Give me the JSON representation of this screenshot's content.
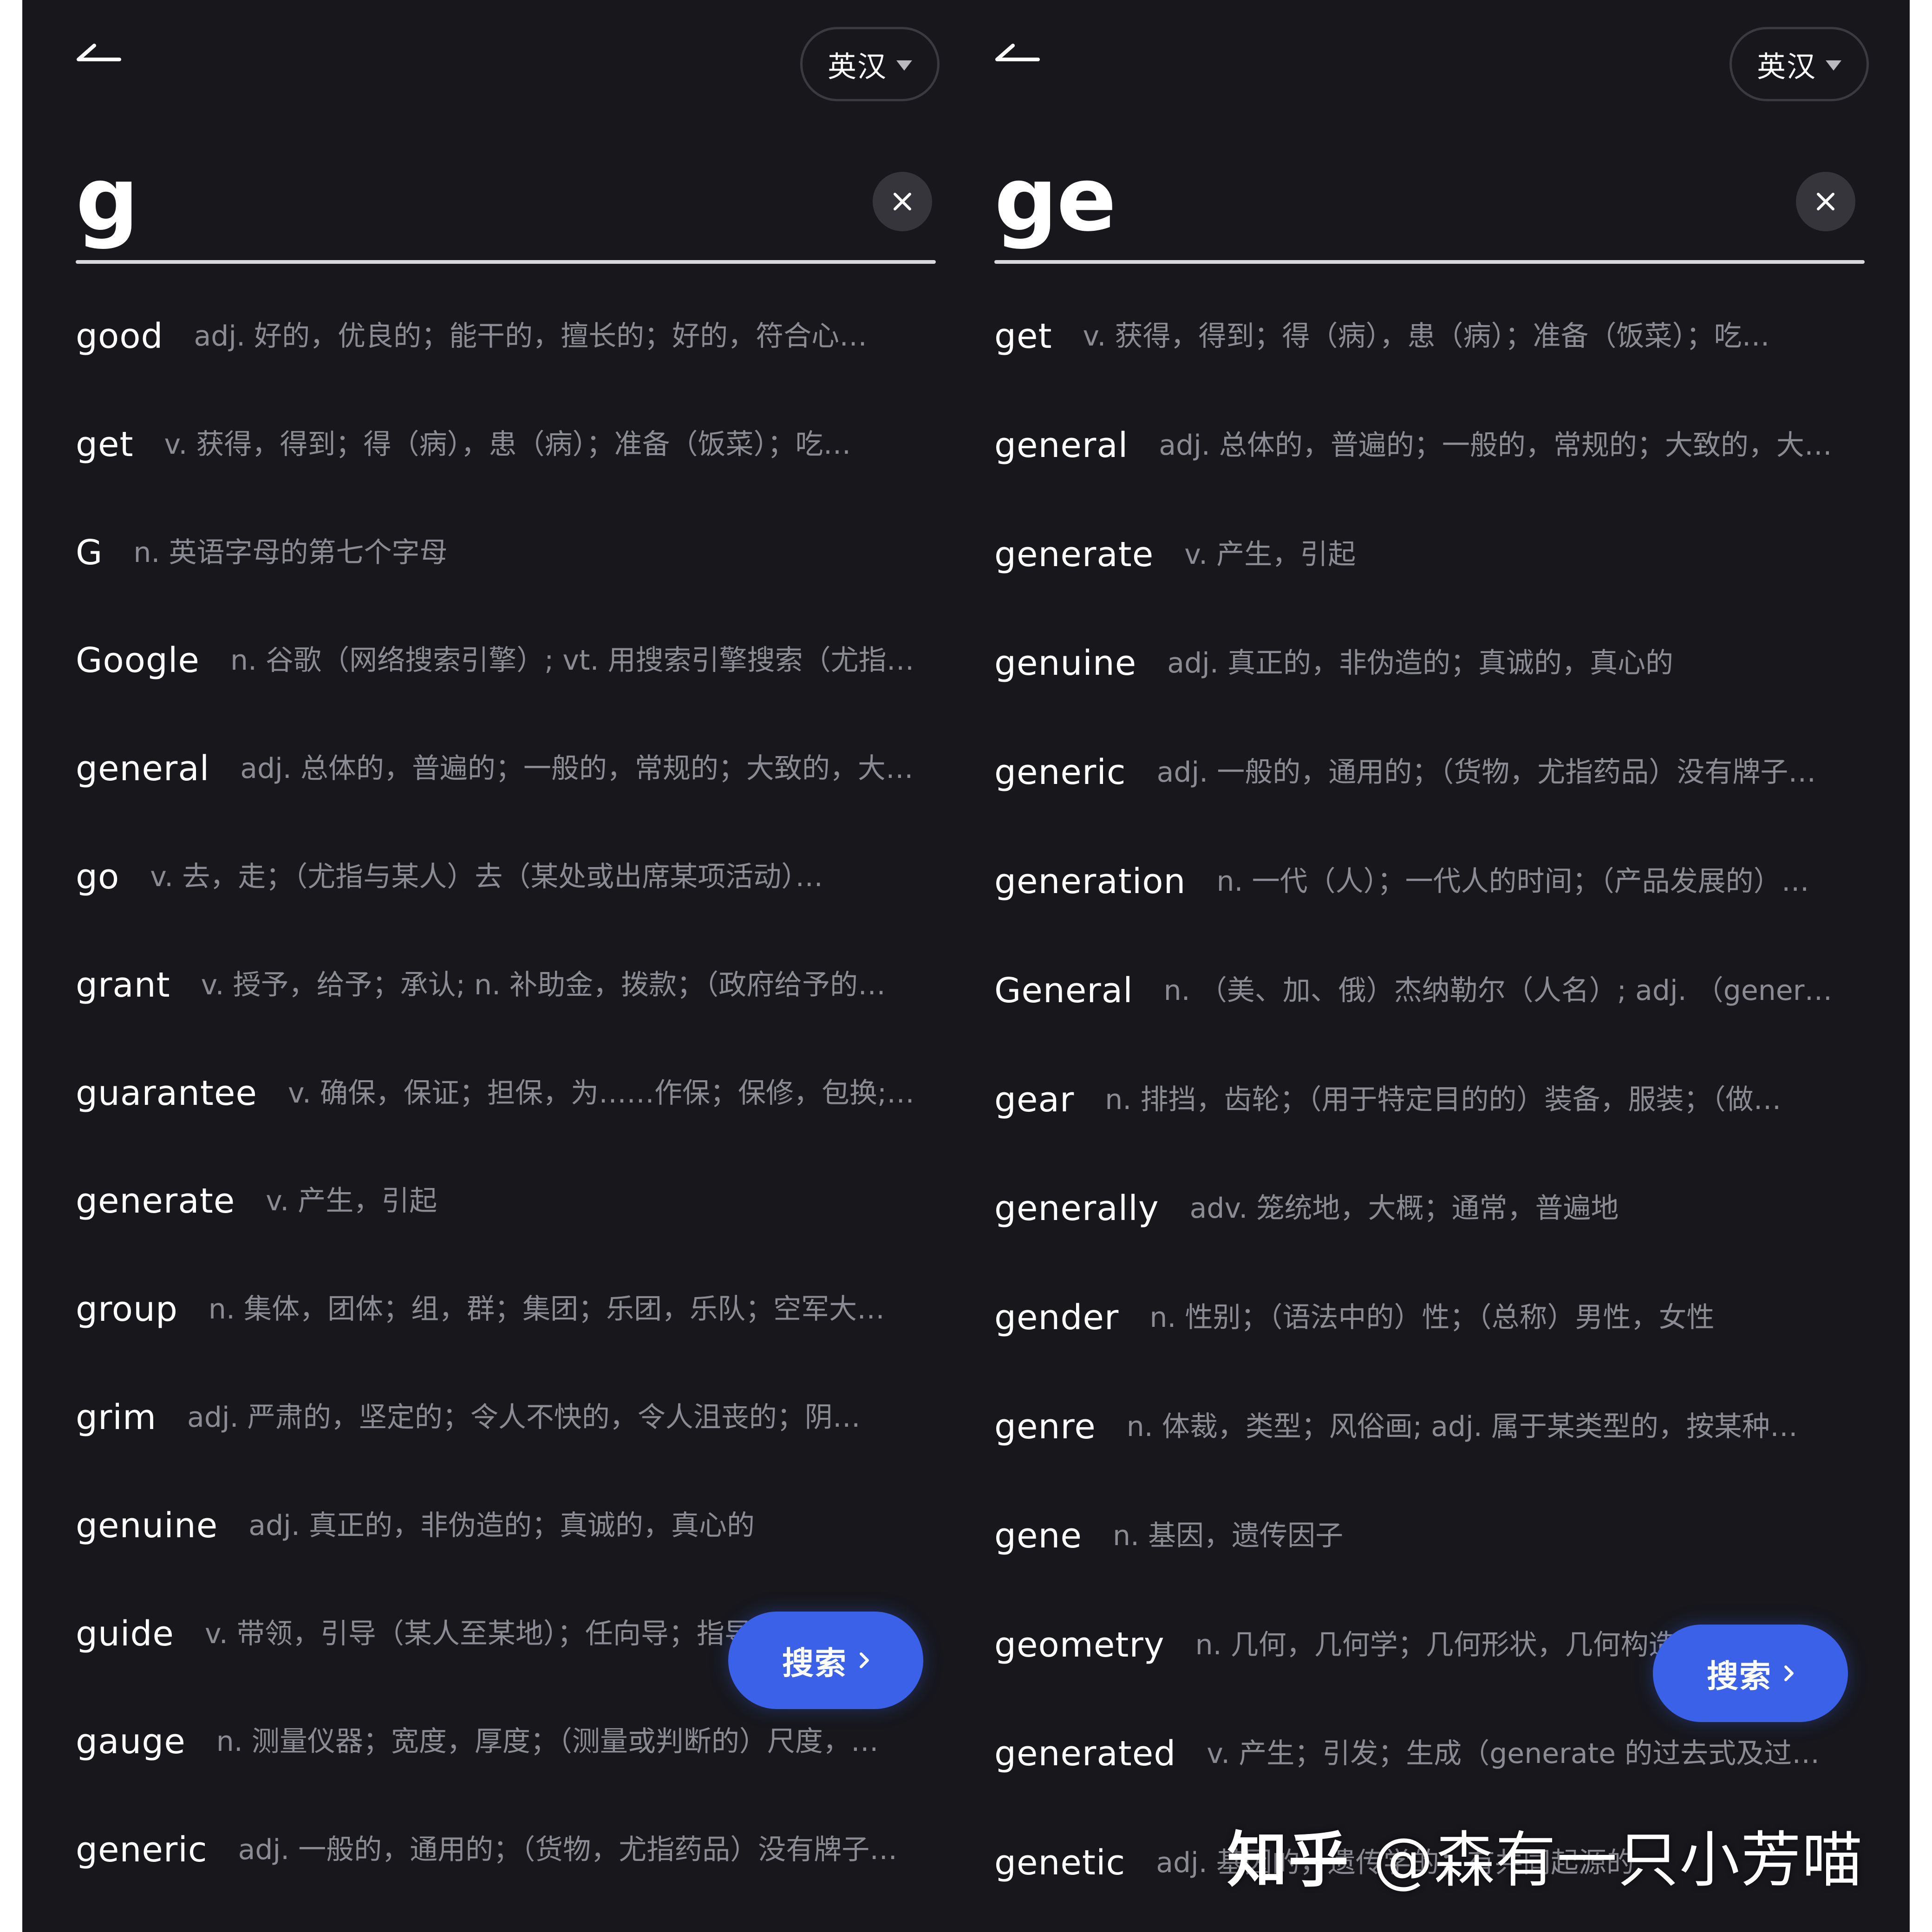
{
  "theme": {
    "background": "#17171c",
    "accent": "#3a61e8",
    "word_color": "#ffffff",
    "definition_color": "#8b8b93"
  },
  "panels": [
    {
      "back_icon": "back-arrow-icon",
      "language": {
        "label": "英汉",
        "icon": "caret-down-icon"
      },
      "search": {
        "query": "g",
        "clear_icon": "close-icon"
      },
      "results": [
        {
          "word": "good",
          "definition": "adj. 好的，优良的；能干的，擅长的；好的，符合心愿…"
        },
        {
          "word": "get",
          "definition": "v. 获得，得到；得（病），患（病）；准备（饭菜）；吃…"
        },
        {
          "word": "G",
          "definition": "n. 英语字母的第七个字母"
        },
        {
          "word": "Google",
          "definition": "n. 谷歌（网络搜索引擎）; vt. 用搜索引擎搜索（尤指…"
        },
        {
          "word": "general",
          "definition": "adj. 总体的，普遍的；一般的，常规的；大致的，大…"
        },
        {
          "word": "go",
          "definition": "v. 去，走；（尤指与某人）去（某处或出席某项活动）；…"
        },
        {
          "word": "grant",
          "definition": "v. 授予，给予；承认; n. 补助金，拨款；（政府给予的…"
        },
        {
          "word": "guarantee",
          "definition": "v. 确保，保证；担保，为……作保；保修，包换;…"
        },
        {
          "word": "generate",
          "definition": "v. 产生，引起"
        },
        {
          "word": "group",
          "definition": "n. 集体，团体；组，群；集团；乐团，乐队；空军大…"
        },
        {
          "word": "grim",
          "definition": "adj. 严肃的，坚定的；令人不快的，令人沮丧的；阴森…"
        },
        {
          "word": "genuine",
          "definition": "adj. 真正的，非伪造的；真诚的，真心的"
        },
        {
          "word": "guide",
          "definition": "v. 带领，引导（某人至某地）；任向导；指导，影响；…"
        },
        {
          "word": "gauge",
          "definition": "n. 测量仪器；宽度，厚度；（测量或判断的）尺度，…"
        },
        {
          "word": "generic",
          "definition": "adj. 一般的，通用的；（货物，尤指药品）没有牌子…"
        }
      ],
      "search_button": {
        "label": "搜索",
        "icon": "chevron-right-icon"
      }
    },
    {
      "back_icon": "back-arrow-icon",
      "language": {
        "label": "英汉",
        "icon": "caret-down-icon"
      },
      "search": {
        "query": "ge",
        "clear_icon": "close-icon"
      },
      "results": [
        {
          "word": "get",
          "definition": "v. 获得，得到；得（病），患（病）；准备（饭菜）；吃…"
        },
        {
          "word": "general",
          "definition": "adj. 总体的，普遍的；一般的，常规的；大致的，大…"
        },
        {
          "word": "generate",
          "definition": "v. 产生，引起"
        },
        {
          "word": "genuine",
          "definition": "adj. 真正的，非伪造的；真诚的，真心的"
        },
        {
          "word": "generic",
          "definition": "adj. 一般的，通用的；（货物，尤指药品）没有牌子…"
        },
        {
          "word": "generation",
          "definition": "n. 一代（人）；一代人的时间；（产品发展的）…"
        },
        {
          "word": "General",
          "definition": "n. （美、加、俄）杰纳勒尔（人名）; adj. （gener…"
        },
        {
          "word": "gear",
          "definition": "n. 排挡，齿轮；（用于特定目的的）装备，服装；（做…"
        },
        {
          "word": "generally",
          "definition": "adv. 笼统地，大概；通常，普遍地"
        },
        {
          "word": "gender",
          "definition": "n. 性别；（语法中的）性；（总称）男性，女性"
        },
        {
          "word": "genre",
          "definition": "n. 体裁，类型；风俗画; adj. 属于某类型的，按某种风…"
        },
        {
          "word": "gene",
          "definition": "n. 基因，遗传因子"
        },
        {
          "word": "geometry",
          "definition": "n. 几何，几何学；几何形状，几何构造；几何体系"
        },
        {
          "word": "generated",
          "definition": "v. 产生；引发；生成（generate 的过去式及过…"
        },
        {
          "word": "genetic",
          "definition": "adj. 基因的，遗传学的；有共同起源的"
        }
      ],
      "search_button": {
        "label": "搜索",
        "icon": "chevron-right-icon"
      }
    }
  ],
  "watermark": {
    "brand": "知乎",
    "handle": "@森有一只小芳喵"
  }
}
